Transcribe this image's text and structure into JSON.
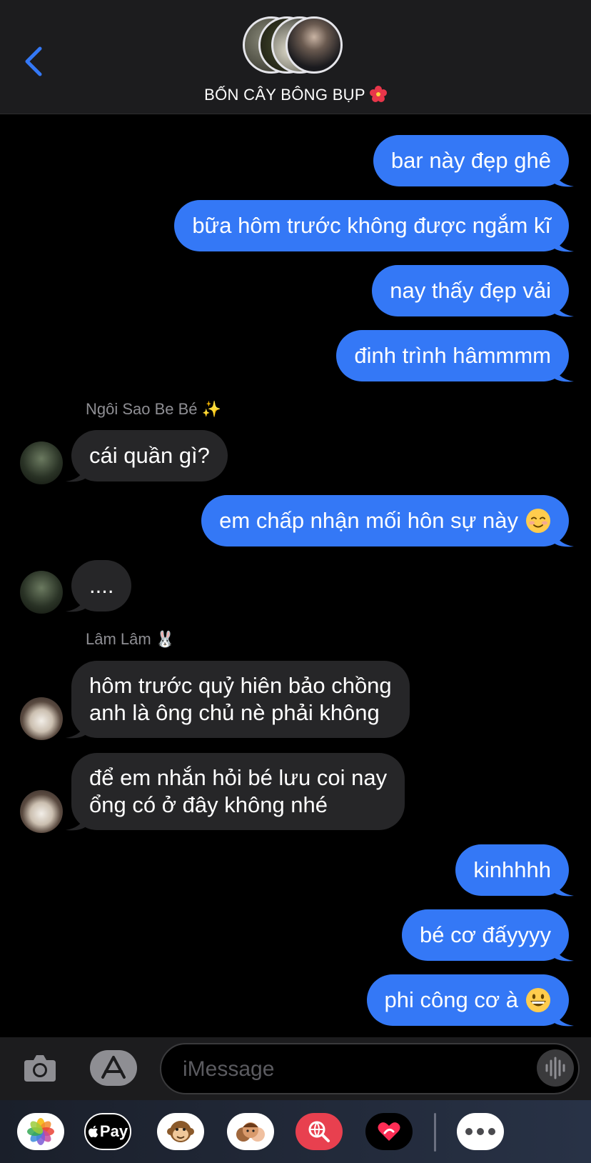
{
  "header": {
    "title": "BỐN CÂY BÔNG BỤP",
    "title_emoji": "hibiscus"
  },
  "messages": [
    {
      "type": "out",
      "text": "bar này đẹp ghê"
    },
    {
      "type": "out",
      "text": "bữa hôm trước không được ngắm kĩ"
    },
    {
      "type": "out",
      "text": "nay thấy đẹp vải"
    },
    {
      "type": "out",
      "text": "đinh trình hâmmmm"
    },
    {
      "type": "sender",
      "text": "Ngôi Sao Be Bé ✨"
    },
    {
      "type": "in",
      "text": "cái quần gì?"
    },
    {
      "type": "out",
      "text": "em chấp nhận mối hôn sự này",
      "emoji": "smiling-face"
    },
    {
      "type": "in",
      "text": "...."
    },
    {
      "type": "sender",
      "text": "Lâm Lâm 🐰"
    },
    {
      "type": "in",
      "lines": [
        "hôm trước quỷ hiên bảo chồng",
        "anh là ông chủ nè phải không"
      ]
    },
    {
      "type": "in",
      "lines": [
        "để em nhắn hỏi bé lưu coi nay",
        "ổng có ở đây không nhé"
      ]
    },
    {
      "type": "out",
      "text": "kinhhhh"
    },
    {
      "type": "out",
      "text": "bé cơ đấyyyy"
    },
    {
      "type": "out",
      "text": "phi công cơ à",
      "emoji": "grinning-face"
    }
  ],
  "input": {
    "placeholder": "iMessage"
  },
  "apps": {
    "apple_pay_label": "Pay",
    "items": [
      "photos-app",
      "apple-pay-app",
      "animoji-app",
      "memoji-app",
      "image-search-app",
      "digital-touch-app",
      "more-apps"
    ]
  },
  "colors": {
    "outgoing_bubble": "#3478f6",
    "incoming_bubble": "#262628",
    "back_chevron": "#3478f6"
  }
}
